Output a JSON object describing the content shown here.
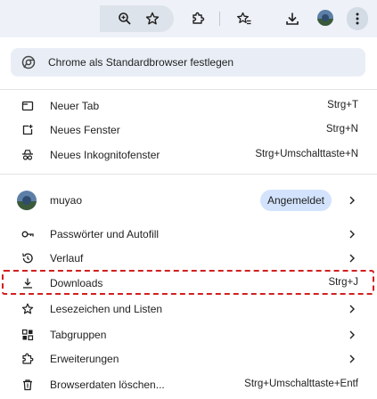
{
  "toolbar": {
    "icons": [
      "zoom-icon",
      "bookmark-star-icon",
      "extensions-icon",
      "bookmarks-list-icon",
      "download-icon",
      "profile-avatar",
      "more-menu-icon"
    ]
  },
  "menu": {
    "promo": {
      "label": "Chrome als Standardbrowser festlegen",
      "icon": "chrome-logo-icon"
    },
    "group1": [
      {
        "label": "Neuer Tab",
        "shortcut": "Strg+T",
        "icon": "new-tab-icon"
      },
      {
        "label": "Neues Fenster",
        "shortcut": "Strg+N",
        "icon": "new-window-icon"
      },
      {
        "label": "Neues Inkognitofenster",
        "shortcut": "Strg+Umschalttaste+N",
        "icon": "incognito-icon"
      }
    ],
    "profile": {
      "name": "muyao",
      "status": "Angemeldet"
    },
    "group2": [
      {
        "label": "Passwörter und Autofill",
        "icon": "key-icon"
      },
      {
        "label": "Verlauf",
        "icon": "history-icon"
      },
      {
        "label": "Downloads",
        "shortcut": "Strg+J",
        "icon": "download-icon"
      },
      {
        "label": "Lesezeichen und Listen",
        "icon": "star-icon"
      },
      {
        "label": "Tabgruppen",
        "icon": "tab-groups-icon"
      },
      {
        "label": "Erweiterungen",
        "icon": "extension-icon"
      },
      {
        "label": "Browserdaten löschen...",
        "shortcut": "Strg+Umschalttaste+Entf",
        "icon": "trash-icon"
      }
    ]
  },
  "colors": {
    "toolbar_bg": "#eef1f8",
    "promo_bg": "#e9eef6",
    "badge_bg": "#d3e3fd",
    "highlight": "#d21f1f"
  }
}
